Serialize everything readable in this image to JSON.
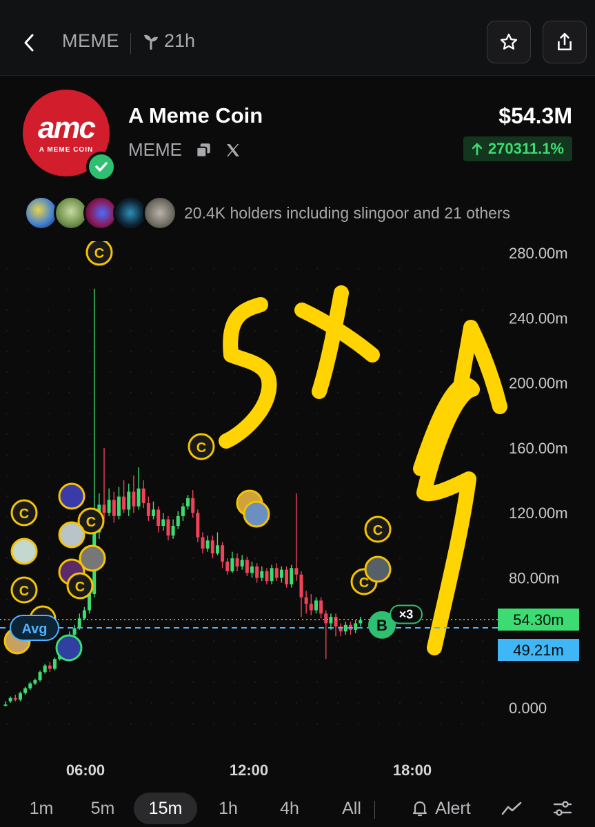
{
  "header": {
    "ticker": "MEME",
    "age": "21h"
  },
  "token": {
    "logo_text": "amc",
    "logo_subtext": "A MEME COIN",
    "name": "A Meme Coin",
    "ticker": "MEME",
    "market_cap": "$54.3M",
    "change": "270311.1%",
    "change_color": "#3ddc72",
    "brand_color": "#d11d2c"
  },
  "holders": {
    "text": "20.4K holders including slingoor and 21 others"
  },
  "chart_data": {
    "type": "candlestick",
    "y_ticks": [
      "280.00m",
      "240.00m",
      "200.00m",
      "160.00m",
      "120.00m",
      "80.00m",
      "0.000"
    ],
    "x_ticks": [
      "06:00",
      "12:00",
      "18:00"
    ],
    "ylim": [
      -20,
      285
    ],
    "current_price_label": "54.30m",
    "current_price": 54.3,
    "avg_price_label": "49.21m",
    "avg_price": 49.21,
    "avg_badge": "Avg",
    "buy_marker": "B",
    "buy_count": "×3",
    "coin_marker": "C",
    "up_color": "#3ddc72",
    "down_color": "#f0435a",
    "annotation_text": "5x",
    "candles": [
      [
        2,
        2,
        4,
        1
      ],
      [
        4,
        6,
        7,
        3
      ],
      [
        6,
        5,
        8,
        4
      ],
      [
        5,
        9,
        10,
        4
      ],
      [
        9,
        12,
        13,
        8
      ],
      [
        12,
        15,
        16,
        11
      ],
      [
        15,
        17,
        18,
        14
      ],
      [
        17,
        22,
        23,
        16
      ],
      [
        22,
        26,
        27,
        21
      ],
      [
        26,
        24,
        28,
        22
      ],
      [
        24,
        30,
        31,
        23
      ],
      [
        30,
        33,
        34,
        29
      ],
      [
        33,
        39,
        40,
        32
      ],
      [
        39,
        45,
        47,
        38
      ],
      [
        45,
        49,
        51,
        44
      ],
      [
        49,
        55,
        58,
        48
      ],
      [
        55,
        60,
        62,
        54
      ],
      [
        60,
        70,
        73,
        58
      ],
      [
        70,
        108,
        258,
        68
      ],
      [
        108,
        125,
        132,
        104
      ],
      [
        125,
        120,
        160,
        116
      ],
      [
        120,
        128,
        135,
        118
      ],
      [
        128,
        118,
        133,
        114
      ],
      [
        118,
        130,
        136,
        116
      ],
      [
        130,
        122,
        140,
        120
      ],
      [
        122,
        133,
        138,
        118
      ],
      [
        133,
        124,
        143,
        120
      ],
      [
        124,
        135,
        148,
        122
      ],
      [
        135,
        126,
        140,
        123
      ],
      [
        126,
        118,
        130,
        115
      ],
      [
        118,
        122,
        127,
        116
      ],
      [
        122,
        112,
        124,
        108
      ],
      [
        112,
        116,
        120,
        109
      ],
      [
        116,
        106,
        118,
        103
      ],
      [
        106,
        112,
        116,
        104
      ],
      [
        112,
        118,
        121,
        110
      ],
      [
        118,
        124,
        126,
        115
      ],
      [
        124,
        129,
        131,
        122
      ],
      [
        129,
        120,
        134,
        117
      ],
      [
        120,
        105,
        122,
        102
      ],
      [
        105,
        98,
        108,
        95
      ],
      [
        98,
        103,
        106,
        96
      ],
      [
        103,
        95,
        106,
        92
      ],
      [
        95,
        100,
        108,
        94
      ],
      [
        100,
        90,
        102,
        86
      ],
      [
        90,
        84,
        92,
        82
      ],
      [
        84,
        92,
        96,
        83
      ],
      [
        92,
        87,
        95,
        84
      ],
      [
        87,
        91,
        94,
        85
      ],
      [
        91,
        83,
        93,
        81
      ],
      [
        83,
        87,
        90,
        80
      ],
      [
        87,
        80,
        89,
        77
      ],
      [
        80,
        84,
        87,
        78
      ],
      [
        84,
        78,
        86,
        76
      ],
      [
        78,
        86,
        88,
        76
      ],
      [
        86,
        80,
        89,
        78
      ],
      [
        80,
        85,
        87,
        77
      ],
      [
        85,
        76,
        87,
        74
      ],
      [
        76,
        86,
        88,
        74
      ],
      [
        86,
        82,
        132,
        78
      ],
      [
        82,
        68,
        84,
        56
      ],
      [
        68,
        64,
        72,
        58
      ],
      [
        64,
        60,
        70,
        57
      ],
      [
        60,
        66,
        68,
        58
      ],
      [
        66,
        58,
        68,
        55
      ],
      [
        58,
        52,
        60,
        30
      ],
      [
        52,
        56,
        58,
        48
      ],
      [
        56,
        50,
        58,
        44
      ],
      [
        50,
        47,
        52,
        44
      ],
      [
        47,
        51,
        53,
        45
      ],
      [
        51,
        48,
        53,
        45
      ],
      [
        48,
        52,
        54,
        46
      ],
      [
        52,
        54,
        56,
        50
      ]
    ]
  }
}
